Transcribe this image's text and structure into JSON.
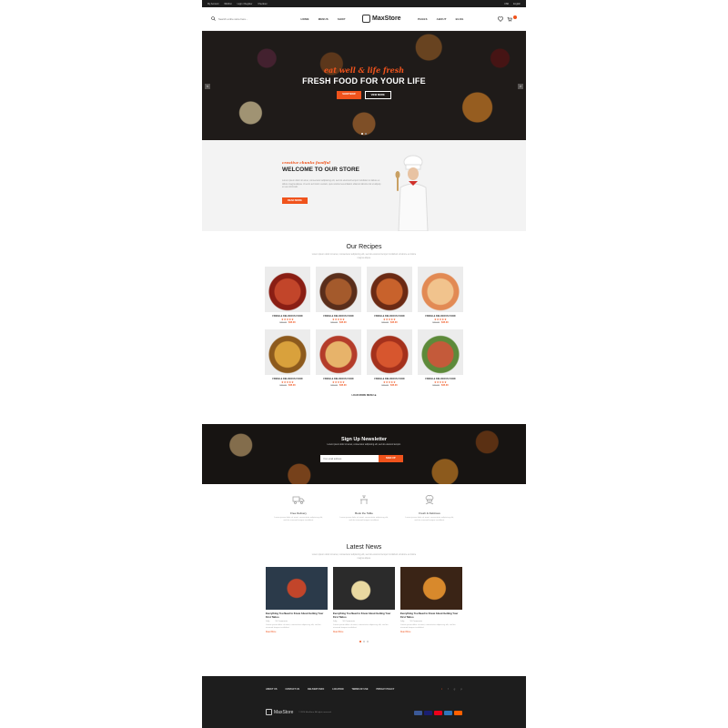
{
  "topbar": {
    "links": [
      "My Account",
      "Wishlist",
      "Login / Register",
      "Checkout"
    ],
    "currency": "USD",
    "language": "English"
  },
  "header": {
    "search_placeholder": "Search entire store here...",
    "nav_left": [
      "HOME",
      "MENUS",
      "SHOP"
    ],
    "logo": "MaxStore",
    "nav_right": [
      "PAGES",
      "ABOUT",
      "BLOG"
    ],
    "cart_count": "0"
  },
  "hero": {
    "script": "eat well & life fresh",
    "headline": "FRESH FOOD FOR YOUR LIFE",
    "btn_primary": "SHOP NOW",
    "btn_secondary": "VIEW MORE",
    "prev": "<",
    "next": ">"
  },
  "welcome": {
    "script": "creative chunks foodful",
    "title": "WELCOME TO OUR STORE",
    "body": "Lorem ipsum dolor sit amet, consectetur adipiscing elit, sed do eiusmod tempor incididunt ut labore et dolore magna aliqua. Ut enim ad minim veniam, quis nostrud exercitation ullamco laboris nisi ut aliquip ex ea commodo.",
    "button": "READ MORE"
  },
  "recipes": {
    "title": "Our Recipes",
    "subtitle": "Lorem ipsum dolor sit amet, consectetur adipiscing elit, sed do eiusmod tempor incididunt ut labore et dolore magna aliqua.",
    "items": [
      {
        "name": "FRESH & DELICIOUS FOOD",
        "stars": "★★★★★",
        "old": "$49.00",
        "price": "$45.00"
      },
      {
        "name": "FRESH & DELICIOUS FOOD",
        "stars": "★★★★★",
        "old": "$49.00",
        "price": "$45.00"
      },
      {
        "name": "FRESH & DELICIOUS FOOD",
        "stars": "★★★★★",
        "old": "$49.00",
        "price": "$45.00"
      },
      {
        "name": "FRESH & DELICIOUS FOOD",
        "stars": "★★★★★",
        "old": "$49.00",
        "price": "$45.00"
      },
      {
        "name": "FRESH & DELICIOUS FOOD",
        "stars": "★★★★★",
        "old": "$49.00",
        "price": "$45.00"
      },
      {
        "name": "FRESH & DELICIOUS FOOD",
        "stars": "★★★★★",
        "old": "$49.00",
        "price": "$45.00"
      },
      {
        "name": "FRESH & DELICIOUS FOOD",
        "stars": "★★★★★",
        "old": "$49.00",
        "price": "$45.00"
      },
      {
        "name": "FRESH & DELICIOUS FOOD",
        "stars": "★★★★★",
        "old": "$49.00",
        "price": "$45.00"
      }
    ],
    "load_more": "LOAD MORE MENU ⊕"
  },
  "newsletter": {
    "title": "Sign Up Newsletter",
    "subtitle": "Lorem ipsum dolor sit amet, consectetur adipiscing elit, sed do eiusmod tempor.",
    "placeholder": "Your email address",
    "button": "SIGN UP"
  },
  "features": [
    {
      "title": "Free Delivery",
      "text": "Lorem ipsum dolor sit amet, consectetur adipiscing elit, sed do eiusmod tempor incididunt."
    },
    {
      "title": "Book the Table",
      "text": "Lorem ipsum dolor sit amet, consectetur adipiscing elit, sed do eiusmod tempor incididunt."
    },
    {
      "title": "Fresh & Delicious",
      "text": "Lorem ipsum dolor sit amet, consectetur adipiscing elit, sed do eiusmod tempor incididunt."
    }
  ],
  "news": {
    "title": "Latest News",
    "subtitle": "Lorem ipsum dolor sit amet, consectetur adipiscing elit, sed do eiusmod tempor incididunt ut labore et dolore magna aliqua.",
    "posts": [
      {
        "title": "Everything You Need to Know About Getting Your First Tattoo",
        "author": "Jolly",
        "comments": "10 Comments",
        "text": "Lorem ipsum dolor sit amet, consectetur adipiscing elit, sed do eiusmod tempor incididunt.",
        "more": "Read More"
      },
      {
        "title": "Everything You Need to Know About Getting Your First Tattoo",
        "author": "Jolly",
        "comments": "10 Comments",
        "text": "Lorem ipsum dolor sit amet, consectetur adipiscing elit, sed do eiusmod tempor incididunt.",
        "more": "Read More"
      },
      {
        "title": "Everything You Need to Know About Getting Your First Tattoo",
        "author": "Jolly",
        "comments": "10 Comments",
        "text": "Lorem ipsum dolor sit amet, consectetur adipiscing elit, sed do eiusmod tempor incididunt.",
        "more": "Read More"
      }
    ]
  },
  "footer": {
    "nav": [
      "ABOUT US",
      "CONTACT US",
      "DELIVERY INFO",
      "LOCATION",
      "TERMS OF USE",
      "PRIVACY POLICY"
    ],
    "logo": "MaxStore",
    "copyright": "© 2020 MaxStore. All rights reserved.",
    "social": [
      "t",
      "f",
      "g",
      "p"
    ]
  },
  "colors": {
    "accent": "#f0531c",
    "dark": "#1d1d1d",
    "light_bg": "#f3f3f3"
  }
}
